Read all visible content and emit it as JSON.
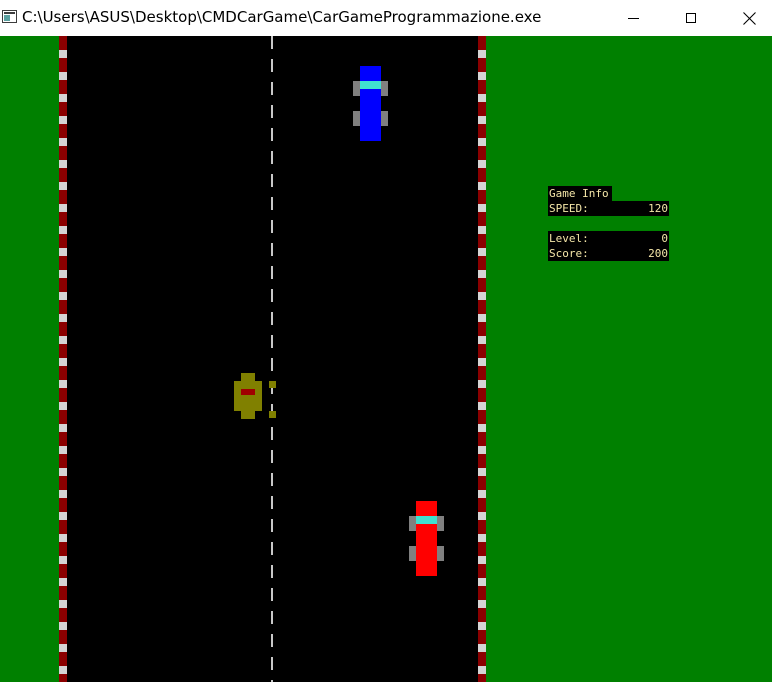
{
  "window": {
    "title": "C:\\Users\\ASUS\\Desktop\\CMDCarGame\\CarGameProgrammazione.exe",
    "controls": {
      "minimize": "minimize",
      "maximize": "maximize",
      "close": "close"
    }
  },
  "hud": {
    "heading": "Game Info",
    "speed_label": "SPEED:",
    "speed_value": "120",
    "level_label": "Level:",
    "level_value": "0",
    "score_label": "Score:",
    "score_value": "200"
  },
  "colors": {
    "grass": "#008000",
    "road": "#000000",
    "kerb_red": "#8b0000",
    "kerb_white": "#d4d4d4",
    "lane_marking": "#c8c8c8",
    "player_car": "#ff0000",
    "enemy_car": "#0000ff",
    "windshield": "#40e0d0",
    "wheels": "#808080",
    "obstacle": "#808000",
    "hud_text": "#f4e6a8",
    "hud_background": "#000000"
  },
  "sprites": {
    "player_car": "red-car",
    "enemy_car": "blue-car",
    "obstacle": "olive-obstacle"
  }
}
